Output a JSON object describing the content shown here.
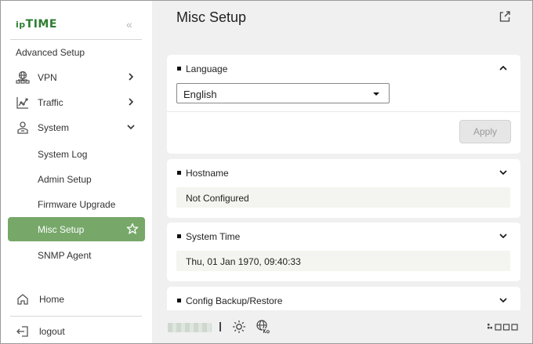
{
  "brand": {
    "logo_prefix": "ip",
    "logo_main": "TIME"
  },
  "sidebar": {
    "collapse_glyph": "«",
    "section_title": "Advanced Setup",
    "items": [
      {
        "label": "VPN",
        "icon": "vpn-network-icon"
      },
      {
        "label": "Traffic",
        "icon": "traffic-chart-icon"
      },
      {
        "label": "System",
        "icon": "system-user-icon"
      }
    ],
    "system_sub": [
      "System Log",
      "Admin Setup",
      "Firmware Upgrade",
      "Misc Setup",
      "SNMP Agent"
    ],
    "active_item": "Misc Setup",
    "home": "Home",
    "logout": "logout"
  },
  "main": {
    "title": "Misc Setup",
    "language": {
      "title": "Language",
      "value": "English",
      "apply": "Apply"
    },
    "hostname": {
      "title": "Hostname",
      "value": "Not Configured"
    },
    "system_time": {
      "title": "System Time",
      "value": "Thu, 01 Jan 1970, 09:40:33"
    },
    "config": {
      "title": "Config Backup/Restore"
    }
  },
  "colors": {
    "accent": "#77a86a",
    "brand": "#2e7d32"
  }
}
